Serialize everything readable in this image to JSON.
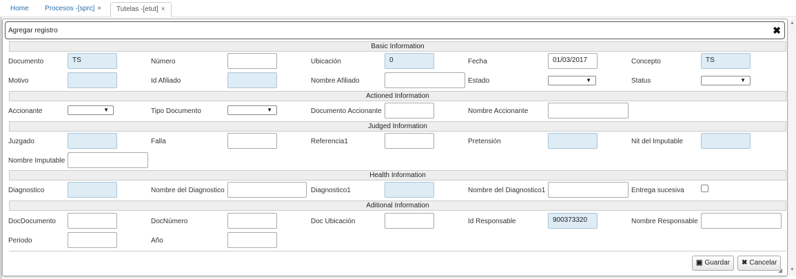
{
  "tabs": [
    {
      "label": "Home",
      "closable": false
    },
    {
      "label": "Procesos -[sprc]",
      "closable": true
    },
    {
      "label": "Tutelas -[etut]",
      "closable": true
    }
  ],
  "tab_close_glyph": "×",
  "dialog": {
    "title": "Agregar registro",
    "close_glyph": "✖"
  },
  "sections": {
    "basic": "Basic Information",
    "actioned": "Actioned Information",
    "judged": "Judged Information",
    "health": "Health Information",
    "aditional": "Aditional Information"
  },
  "fields": {
    "documento": {
      "label": "Documento",
      "value": "TS"
    },
    "numero": {
      "label": "Número",
      "value": ""
    },
    "ubicacion": {
      "label": "Ubicación",
      "value": "0"
    },
    "fecha": {
      "label": "Fecha",
      "value": "01/03/2017"
    },
    "concepto": {
      "label": "Concepto",
      "value": "TS"
    },
    "motivo": {
      "label": "Motivo",
      "value": ""
    },
    "id_afiliado": {
      "label": "Id Afiliado",
      "value": ""
    },
    "nombre_afiliado": {
      "label": "Nombre Afiliado",
      "value": ""
    },
    "estado": {
      "label": "Estado",
      "value": ""
    },
    "status": {
      "label": "Status",
      "value": ""
    },
    "accionante": {
      "label": "Accionante",
      "value": ""
    },
    "tipo_documento": {
      "label": "Tipo Documento",
      "value": ""
    },
    "documento_accionante": {
      "label": "Documento Accionante",
      "value": ""
    },
    "nombre_accionante": {
      "label": "Nombre Accionante",
      "value": ""
    },
    "juzgado": {
      "label": "Juzgado",
      "value": ""
    },
    "falla": {
      "label": "Falla",
      "value": ""
    },
    "referencia1": {
      "label": "Referencia1",
      "value": ""
    },
    "pretension": {
      "label": "Pretensión",
      "value": ""
    },
    "nit_imputable": {
      "label": "Nit del Imputable",
      "value": ""
    },
    "nombre_imputable": {
      "label": "Nombre Imputable",
      "value": ""
    },
    "diagnostico": {
      "label": "Diagnostico",
      "value": ""
    },
    "nombre_diagnostico": {
      "label": "Nombre del Diagnostico",
      "value": ""
    },
    "diagnostico1": {
      "label": "Diagnostico1",
      "value": ""
    },
    "nombre_diagnostico1": {
      "label": "Nombre del Diagnostico1",
      "value": ""
    },
    "entrega_sucesiva": {
      "label": "Entrega sucesiva",
      "checked": false
    },
    "doc_documento": {
      "label": "DocDocumento",
      "value": ""
    },
    "doc_numero": {
      "label": "DocNúmero",
      "value": ""
    },
    "doc_ubicacion": {
      "label": "Doc Ubicación",
      "value": ""
    },
    "id_responsable": {
      "label": "Id Responsable",
      "value": "900373320"
    },
    "nombre_responsable": {
      "label": "Nombre Responsable",
      "value": ""
    },
    "periodo": {
      "label": "Periodo",
      "value": ""
    },
    "anio": {
      "label": "Año",
      "value": ""
    }
  },
  "select_arrow": "▼",
  "buttons": {
    "guardar": {
      "label": "Guardar",
      "icon": "save-icon",
      "glyph": "▣"
    },
    "cancelar": {
      "label": "Cancelar",
      "icon": "close-icon",
      "glyph": "✖"
    }
  },
  "colors": {
    "readonly_fill": "#ddecf5",
    "tab_link": "#2a6fb0",
    "section_fill": "#eeeeee"
  }
}
